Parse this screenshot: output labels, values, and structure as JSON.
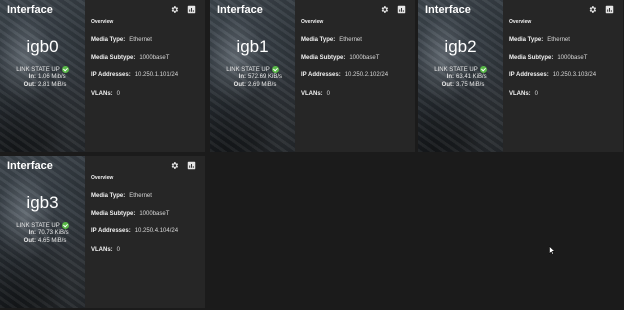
{
  "cards": [
    {
      "title": "Interface",
      "name": "igb0",
      "link_state": "LINK STATE UP",
      "in_label": "In:",
      "in_value": "1.06 Mib/s",
      "out_label": "Out:",
      "out_value": "2.81 MiB/s",
      "overview": "Overview",
      "media_type_label": "Media Type:",
      "media_type": "Ethernet",
      "media_subtype_label": "Media Subtype:",
      "media_subtype": "1000baseT",
      "ip_label": "IP Addresses:",
      "ip": "10.250.1.101/24",
      "vlans_label": "VLANs:",
      "vlans": "0"
    },
    {
      "title": "Interface",
      "name": "igb1",
      "link_state": "LINK STATE UP",
      "in_label": "In:",
      "in_value": "572.69 KiB/s",
      "out_label": "Out:",
      "out_value": "2.69 MiB/s",
      "overview": "Overview",
      "media_type_label": "Media Type:",
      "media_type": "Ethernet",
      "media_subtype_label": "Media Subtype:",
      "media_subtype": "1000baseT",
      "ip_label": "IP Addresses:",
      "ip": "10.250.2.102/24",
      "vlans_label": "VLANs:",
      "vlans": "0"
    },
    {
      "title": "Interface",
      "name": "igb2",
      "link_state": "LINK STATE UP",
      "in_label": "In:",
      "in_value": "63.41 KiB/s",
      "out_label": "Out:",
      "out_value": "3.75 MiB/s",
      "overview": "Overview",
      "media_type_label": "Media Type:",
      "media_type": "Ethernet",
      "media_subtype_label": "Media Subtype:",
      "media_subtype": "1000baseT",
      "ip_label": "IP Addresses:",
      "ip": "10.250.3.103/24",
      "vlans_label": "VLANs:",
      "vlans": "0"
    },
    {
      "title": "Interface",
      "name": "igb3",
      "link_state": "LINK STATE UP",
      "in_label": "In:",
      "in_value": "70.73 KiB/s",
      "out_label": "Out:",
      "out_value": "4.65 MiB/s",
      "overview": "Overview",
      "media_type_label": "Media Type:",
      "media_type": "Ethernet",
      "media_subtype_label": "Media Subtype:",
      "media_subtype": "1000baseT",
      "ip_label": "IP Addresses:",
      "ip": "10.250.4.104/24",
      "vlans_label": "VLANs:",
      "vlans": "0"
    }
  ],
  "icons": {
    "settings": "gear-icon",
    "chart": "chart-icon",
    "status": "check-circle-icon"
  },
  "colors": {
    "background": "#1b1b1b",
    "card": "#262626",
    "status_ok": "#58b947"
  }
}
